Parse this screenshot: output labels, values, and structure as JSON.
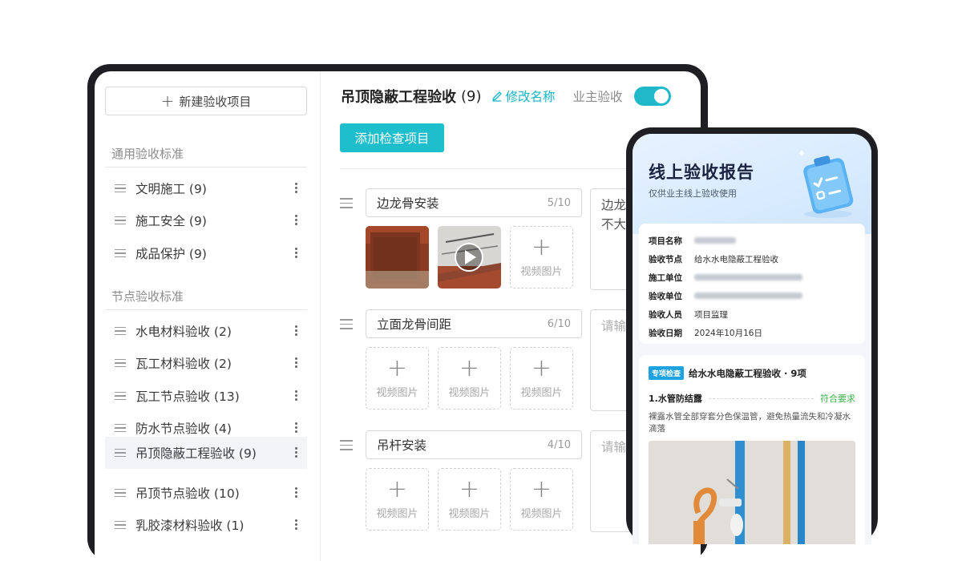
{
  "sidebar": {
    "new_button": "新建验收项目",
    "sections": [
      {
        "title": "通用验收标准"
      },
      {
        "title": "节点验收标准"
      }
    ],
    "general_items": [
      {
        "label": "文明施工 (9)"
      },
      {
        "label": "施工安全 (9)"
      },
      {
        "label": "成品保护 (9)"
      }
    ],
    "node_items": [
      {
        "label": "水电材料验收 (2)"
      },
      {
        "label": "瓦工材料验收 (2)"
      },
      {
        "label": "瓦工节点验收 (13)"
      },
      {
        "label": "防水节点验收 (4)"
      },
      {
        "label": "吊顶隐蔽工程验收 (9)"
      },
      {
        "label": "吊顶节点验收 (10)"
      },
      {
        "label": "乳胶漆材料验收 (1)"
      }
    ]
  },
  "main": {
    "title": "吊顶隐蔽工程验收",
    "count": "(9)",
    "rename": "修改名称",
    "owner_label": "业主验收",
    "owner_toggle": "on",
    "add_button": "添加检查项目",
    "upload_label": "视频图片",
    "items": [
      {
        "name": "边龙骨安装",
        "count": "5/10",
        "note_line1": "边龙",
        "note_line2": "不大"
      },
      {
        "name": "立面龙骨间距",
        "count": "6/10",
        "note_placeholder": "请输"
      },
      {
        "name": "吊杆安装",
        "count": "4/10",
        "note_placeholder": "请输"
      }
    ]
  },
  "phone": {
    "title": "线上验收报告",
    "subtitle": "仅供业主线上验收使用",
    "info": [
      {
        "key": "项目名称",
        "value": ""
      },
      {
        "key": "验收节点",
        "value": "给水水电隐蔽工程验收"
      },
      {
        "key": "施工单位",
        "value": ""
      },
      {
        "key": "验收单位",
        "value": ""
      },
      {
        "key": "验收人员",
        "value": "项目监理"
      },
      {
        "key": "验收日期",
        "value": "2024年10月16日"
      }
    ],
    "section": {
      "tag": "专项检查",
      "title": "给水水电隐蔽工程验收 · 9项",
      "req_name": "1.水管防结露",
      "req_status": "符合要求",
      "req_desc": "裸露水管全部穿套分色保温管，避免热量流失和冷凝水滴落"
    }
  },
  "colors": {
    "accent": "#1fbecd",
    "link": "#17b5c8",
    "ok": "#3bb54a",
    "frame": "#1f1f23"
  }
}
